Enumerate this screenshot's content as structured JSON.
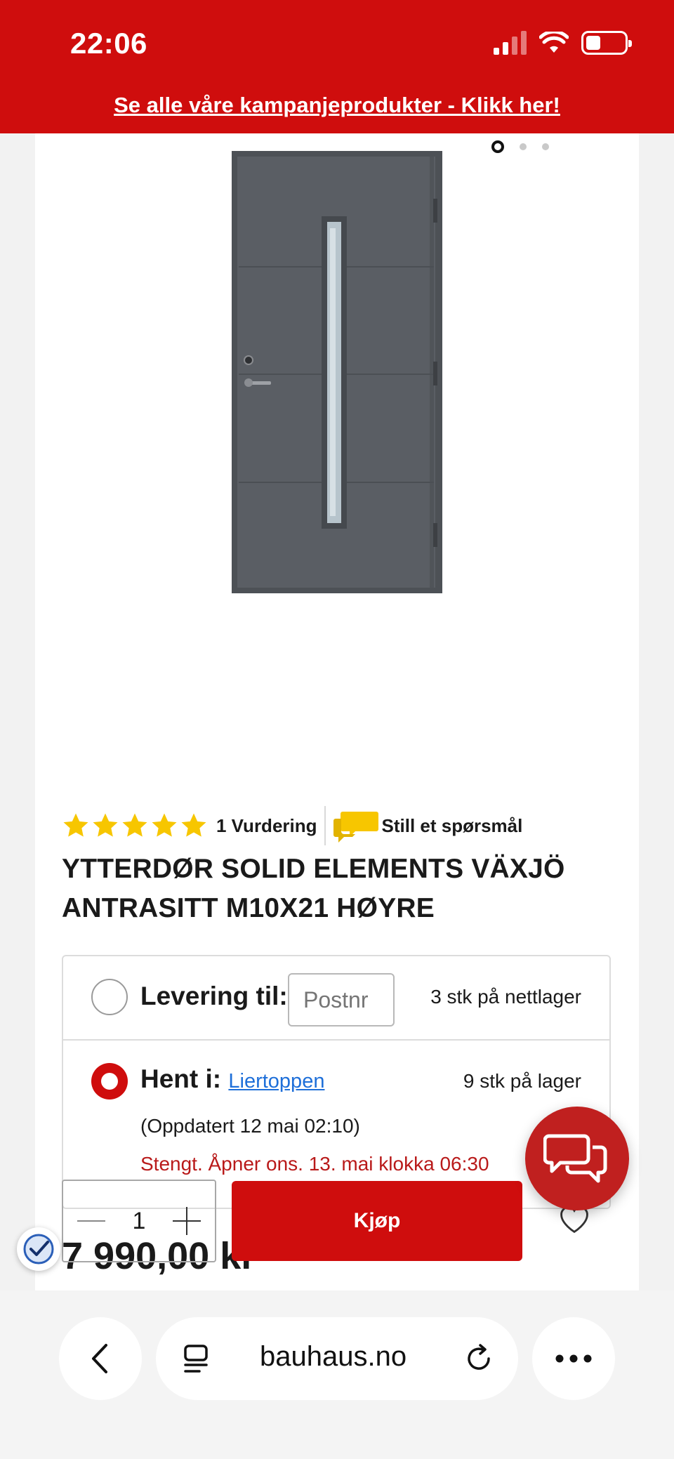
{
  "status_bar": {
    "time": "22:06"
  },
  "promo": {
    "text": "Se alle våre kampanjeprodukter - Klikk her!"
  },
  "gallery": {
    "image_count": 3,
    "active_index": 1
  },
  "product": {
    "rating_value": 5,
    "rating_text": "1 Vurdering",
    "ask_question": "Still et spørsmål",
    "title": "YTTERDØR SOLID ELEMENTS VÄXJÖ ANTRASITT M10X21 HØYRE"
  },
  "delivery": {
    "label": "Levering til:",
    "postcode_placeholder": "Postnr",
    "stock": "3 stk på nettlager",
    "selected": false
  },
  "pickup": {
    "label": "Hent i:",
    "store": "Liertoppen",
    "stock": "9 stk på lager",
    "updated": "(Oppdatert 12 mai 02:10)",
    "opening": "Stengt. Åpner ons. 13. mai klokka 06:30",
    "selected": true
  },
  "price": "7 990,00 kr",
  "purchase": {
    "quantity": "1",
    "buy_label": "Kjøp"
  },
  "browser": {
    "url": "bauhaus.no"
  },
  "colors": {
    "brand_red": "#cf0d0d",
    "star_yellow": "#f7c600",
    "link_blue": "#1e6fd9",
    "door_grey": "#5a5e64"
  }
}
